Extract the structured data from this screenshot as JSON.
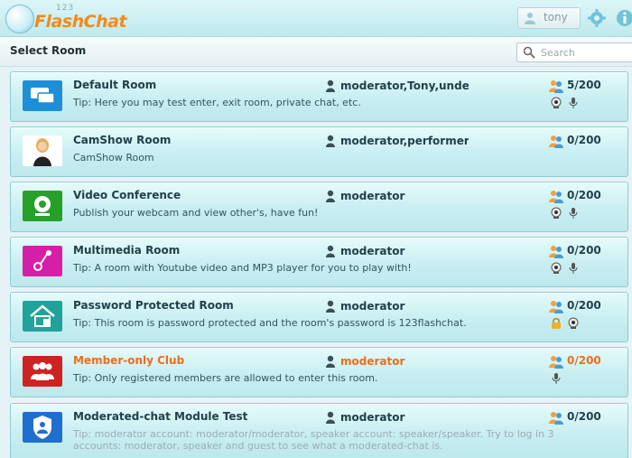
{
  "app": {
    "logo_prefix": "123",
    "logo_name": "FlashChat"
  },
  "user": {
    "name": "tony"
  },
  "subbar": {
    "title": "Select Room",
    "search_placeholder": "Search"
  },
  "rooms": [
    {
      "name": "Default Room",
      "tip": "Tip: Here you may test enter, exit room, private chat, etc.",
      "moderators": "moderator,Tony,undefined",
      "count": "5/200",
      "icon": "chat-bubbles-icon",
      "features": [
        "webcam-icon",
        "microphone-icon"
      ]
    },
    {
      "name": "CamShow Room",
      "tip": "CamShow Room",
      "moderators": "moderator,performer",
      "count": "0/200",
      "icon": "performer-photo",
      "features": []
    },
    {
      "name": "Video Conference",
      "tip": "Publish your webcam and view other's, have fun!",
      "moderators": "moderator",
      "count": "0/200",
      "icon": "webcam-room-icon",
      "features": [
        "webcam-icon",
        "microphone-icon"
      ]
    },
    {
      "name": "Multimedia Room",
      "tip": "Tip: A room with Youtube video and MP3 player for you to play with!",
      "moderators": "moderator",
      "count": "0/200",
      "icon": "music-note-icon",
      "features": [
        "webcam-icon",
        "microphone-icon"
      ]
    },
    {
      "name": "Password Protected Room",
      "tip": "Tip: This room is password protected and the room's password is 123flashchat.",
      "moderators": "moderator",
      "count": "0/200",
      "icon": "house-lock-icon",
      "features": [
        "lock-icon",
        "webcam-icon"
      ]
    },
    {
      "name": "Member-only Club",
      "tip": "Tip: Only registered members are allowed to enter this room.",
      "moderators": "moderator",
      "count": "0/200",
      "icon": "members-group-icon",
      "features": [
        "microphone-icon"
      ]
    },
    {
      "name": "Moderated-chat Module Test",
      "tip": "Tip: moderator account: moderator/moderator, speaker account: speaker/speaker. Try to log in 3 accounts: moderator, speaker and guest to see what a moderated-chat is.",
      "moderators": "moderator",
      "count": "0/200",
      "icon": "shield-user-icon",
      "features": []
    }
  ],
  "colors": {
    "accent_orange": "#ef6c1a",
    "row_border": "#8fcbd4"
  }
}
